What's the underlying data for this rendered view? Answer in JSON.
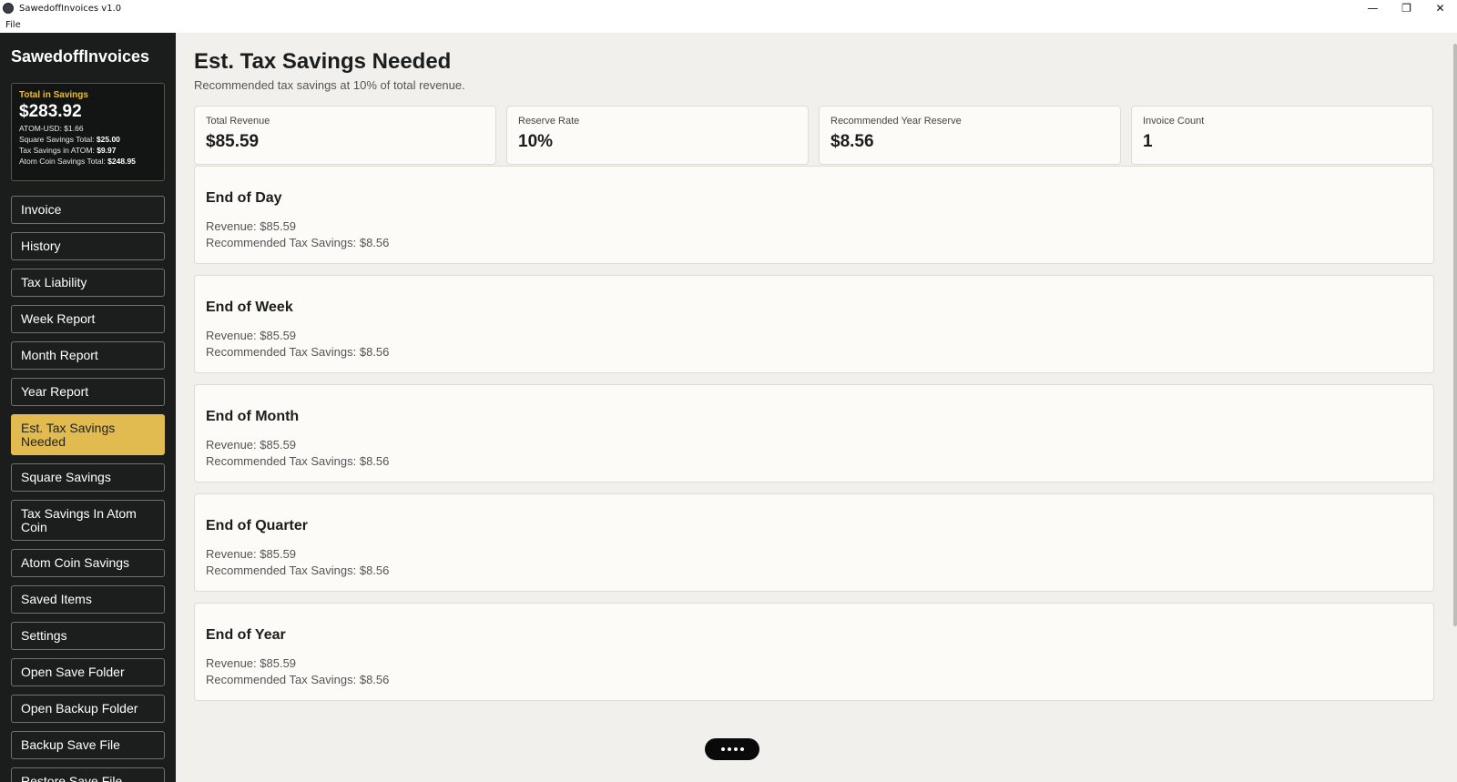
{
  "window": {
    "title": "SawedoffInvoices v1.0",
    "minimize_glyph": "—",
    "restore_glyph": "❐",
    "close_glyph": "✕"
  },
  "menubar": {
    "file": "File"
  },
  "sidebar": {
    "brand": "SawedoffInvoices",
    "savings": {
      "label": "Total in Savings",
      "total": "$283.92",
      "atom_usd": "ATOM-USD: $1.66",
      "square_label": "Square Savings Total: ",
      "square_value": "$25.00",
      "tax_atom_label": "Tax Savings in ATOM: ",
      "tax_atom_value": "$9.97",
      "atom_coin_label": "Atom Coin Savings Total: ",
      "atom_coin_value": "$248.95"
    },
    "items": [
      {
        "label": "Invoice"
      },
      {
        "label": "History"
      },
      {
        "label": "Tax Liability"
      },
      {
        "label": "Week Report"
      },
      {
        "label": "Month Report"
      },
      {
        "label": "Year Report"
      },
      {
        "label": "Est. Tax Savings Needed"
      },
      {
        "label": "Square Savings"
      },
      {
        "label": "Tax Savings In Atom Coin"
      },
      {
        "label": "Atom Coin Savings"
      },
      {
        "label": "Saved Items"
      },
      {
        "label": "Settings"
      },
      {
        "label": "Open Save Folder"
      },
      {
        "label": "Open Backup Folder"
      },
      {
        "label": "Backup Save File"
      },
      {
        "label": "Restore Save File"
      }
    ]
  },
  "main": {
    "title": "Est. Tax Savings Needed",
    "subtitle": "Recommended tax savings at 10% of total revenue.",
    "stats": [
      {
        "label": "Total Revenue",
        "value": "$85.59"
      },
      {
        "label": "Reserve Rate",
        "value": "10%"
      },
      {
        "label": "Recommended Year Reserve",
        "value": "$8.56"
      },
      {
        "label": "Invoice Count",
        "value": "1"
      }
    ],
    "periods": [
      {
        "title": "End of Day",
        "revenue": "Revenue: $85.59",
        "savings": "Recommended Tax Savings: $8.56"
      },
      {
        "title": "End of Week",
        "revenue": "Revenue: $85.59",
        "savings": "Recommended Tax Savings: $8.56"
      },
      {
        "title": "End of Month",
        "revenue": "Revenue: $85.59",
        "savings": "Recommended Tax Savings: $8.56"
      },
      {
        "title": "End of Quarter",
        "revenue": "Revenue: $85.59",
        "savings": "Recommended Tax Savings: $8.56"
      },
      {
        "title": "End of Year",
        "revenue": "Revenue: $85.59",
        "savings": "Recommended Tax Savings: $8.56"
      }
    ]
  },
  "colors": {
    "accent": "#e1bb50",
    "sidebar_bg": "#1b1d1c",
    "main_bg": "#f1f0ec"
  }
}
